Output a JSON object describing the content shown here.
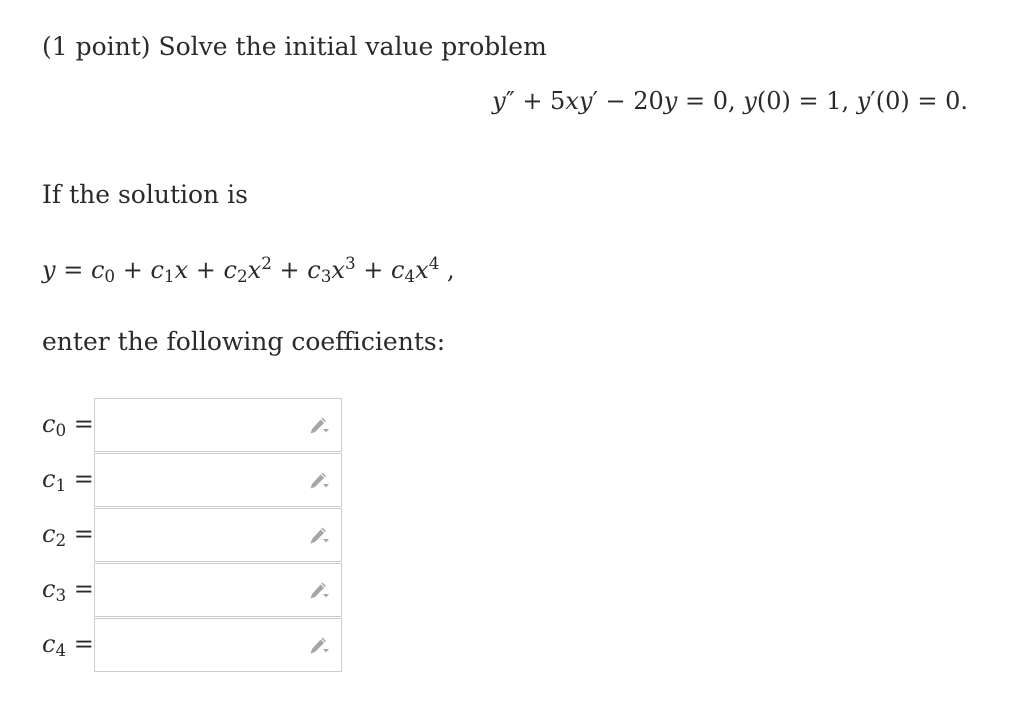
{
  "problem": {
    "header": "(1 point) Solve the initial value problem",
    "ode": {
      "y": "y",
      "prime2": "″",
      "plus1": " + 5",
      "x": "x",
      "y2": "y",
      "prime1": "′",
      "minus": " − 20",
      "y3": "y",
      "eq0": " = 0, ",
      "y4": "y",
      "ic1": "(0) = 1, ",
      "y5": "y",
      "prime3": "′",
      "ic2": "(0) = 0."
    },
    "if_text": "If the solution is",
    "series": {
      "lhs": "y",
      "eq": " = ",
      "terms": [
        {
          "c": "c",
          "sub": "0",
          "x": "",
          "sup": ""
        },
        {
          "c": "c",
          "sub": "1",
          "x": "x",
          "sup": ""
        },
        {
          "c": "c",
          "sub": "2",
          "x": "x",
          "sup": "2"
        },
        {
          "c": "c",
          "sub": "3",
          "x": "x",
          "sup": "3"
        },
        {
          "c": "c",
          "sub": "4",
          "x": "x",
          "sup": "4"
        }
      ],
      "plus": " + ",
      "trail": " ,"
    },
    "enter_text": "enter the following coefficients:"
  },
  "coefficients": [
    {
      "var": "c",
      "sub": "0",
      "eq": " =",
      "value": ""
    },
    {
      "var": "c",
      "sub": "1",
      "eq": " =",
      "value": ""
    },
    {
      "var": "c",
      "sub": "2",
      "eq": " =",
      "value": ""
    },
    {
      "var": "c",
      "sub": "3",
      "eq": " =",
      "value": ""
    },
    {
      "var": "c",
      "sub": "4",
      "eq": " =",
      "value": ""
    }
  ],
  "icons": {
    "answer_field": "pencil-icon"
  },
  "colors": {
    "text": "#2a2a2a",
    "input_border": "#cccccc",
    "pencil_fill": "#a6a6a6"
  }
}
